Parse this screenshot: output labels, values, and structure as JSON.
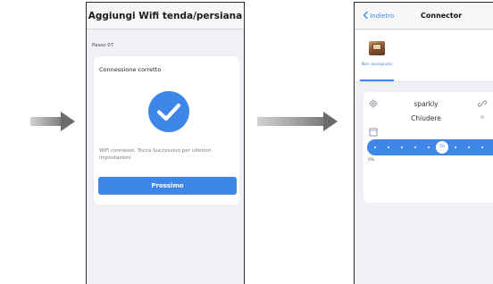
{
  "phone1": {
    "header_title": "Aggiungi Wifi tenda/persiana",
    "step_label": "Passo 07",
    "card_title": "Connessione corretto",
    "message": "WiFi connesso. Tocca Successivo  per ulteriori impostazioni.",
    "next_button": "Prossimo",
    "accent_color": "#3e86e8"
  },
  "phone2": {
    "back_label": "Indietro",
    "title": "Connector",
    "device_tab_label": "Non assegnato",
    "device_name": "sparkly",
    "action_label": "Chiudere",
    "slider_value": "50",
    "min_label": "0%",
    "icons": [
      "settings-icon",
      "link-icon",
      "star-icon",
      "blind-icon"
    ],
    "accent_color": "#3e86e8"
  }
}
